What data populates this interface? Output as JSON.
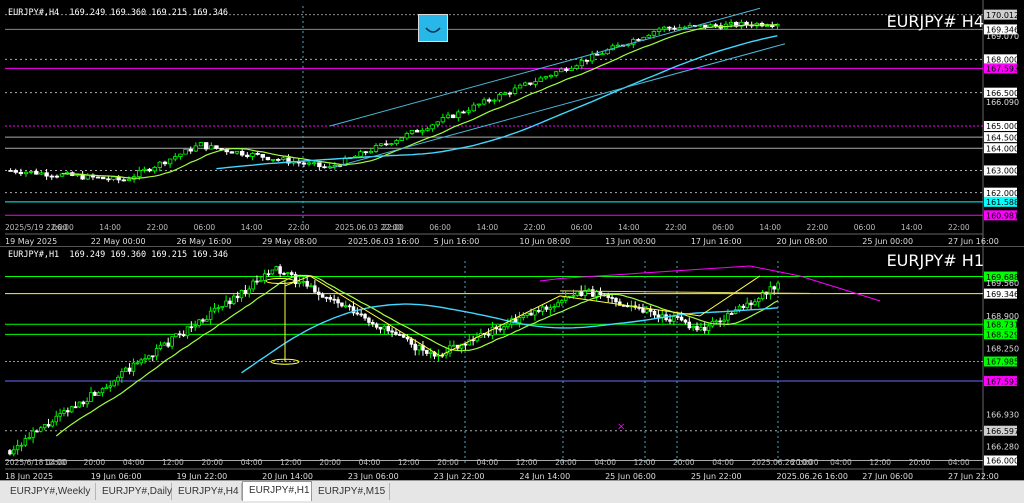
{
  "h4": {
    "symbol_line": "EURJPY#,H4  169.249 169.360 169.215 169.346",
    "title": "EURJPY# H4",
    "y_min": 160.5,
    "y_max": 170.4,
    "price_labels": [
      {
        "text": "170.012",
        "v": 170.012,
        "bg": "#cfcfcf",
        "fg": "#000"
      },
      {
        "text": "169.346",
        "v": 169.346,
        "bg": "#ffffff",
        "fg": "#000"
      },
      {
        "text": "169.070",
        "v": 169.07,
        "bg": "",
        "fg": "#ddd"
      },
      {
        "text": "168.000",
        "v": 168.0,
        "bg": "#ffffff",
        "fg": "#000"
      },
      {
        "text": "167.593",
        "v": 167.593,
        "bg": "#ff00ff",
        "fg": "#000"
      },
      {
        "text": "166.500",
        "v": 166.5,
        "bg": "#ffffff",
        "fg": "#000"
      },
      {
        "text": "166.090",
        "v": 166.09,
        "bg": "",
        "fg": "#ddd"
      },
      {
        "text": "165.000",
        "v": 165.0,
        "bg": "#ffffff",
        "fg": "#000"
      },
      {
        "text": "164.500",
        "v": 164.5,
        "bg": "#ffffff",
        "fg": "#000"
      },
      {
        "text": "164.000",
        "v": 164.0,
        "bg": "#ffffff",
        "fg": "#000"
      },
      {
        "text": "163.000",
        "v": 163.0,
        "bg": "#ffffff",
        "fg": "#000"
      },
      {
        "text": "162.000",
        "v": 162.0,
        "bg": "#ffffff",
        "fg": "#000"
      },
      {
        "text": "161.588",
        "v": 161.588,
        "bg": "#00ffff",
        "fg": "#000"
      },
      {
        "text": "160.981",
        "v": 160.981,
        "bg": "#ff00ff",
        "fg": "#000"
      }
    ],
    "hlines": [
      {
        "v": 170.012,
        "color": "#888888",
        "dash": "2,2"
      },
      {
        "v": 169.346,
        "color": "#888888",
        "dash": ""
      },
      {
        "v": 168.0,
        "color": "#aaaaaa",
        "dash": "2,3"
      },
      {
        "v": 167.593,
        "color": "#ff00ff",
        "dash": ""
      },
      {
        "v": 166.5,
        "color": "#aaaaaa",
        "dash": "2,3"
      },
      {
        "v": 165.0,
        "color": "#ff00ff",
        "dash": "2,2"
      },
      {
        "v": 164.5,
        "color": "#aaaaaa",
        "dash": ""
      },
      {
        "v": 164.0,
        "color": "#aaaaaa",
        "dash": ""
      },
      {
        "v": 163.0,
        "color": "#aaaaaa",
        "dash": "2,3"
      },
      {
        "v": 162.0,
        "color": "#aaaaaa",
        "dash": "2,3"
      },
      {
        "v": 161.588,
        "color": "#00ffff",
        "dash": ""
      },
      {
        "v": 160.981,
        "color": "#ff00ff",
        "dash": ""
      }
    ],
    "date_labels": [
      "19 May 2025",
      "22 May 00:00",
      "26 May 16:00",
      "29 May 08:00",
      "2025.06.03 16:00",
      "5 Jun 16:00",
      "10 Jun 08:00",
      "13 Jun 00:00",
      "17 Jun 16:00",
      "20 Jun 08:00",
      "25 Jun 00:00",
      "27 Jun 16:00"
    ],
    "upper_time_labels": [
      "2025/5/19 22:00",
      "06:00",
      "14:00",
      "22:00",
      "06:00",
      "14:00",
      "22:00",
      "2025.06.03 22:00",
      "22:00",
      "06:00",
      "14:00",
      "22:00",
      "06:00",
      "14:00",
      "22:00",
      "06:00",
      "14:00",
      "22:00",
      "06:00",
      "14:00",
      "22:00"
    ]
  },
  "h1": {
    "symbol_line": "EURJPY#,H1  169.249 169.360 169.215 169.346",
    "title": "EURJPY# H1",
    "y_min": 165.95,
    "y_max": 170.0,
    "price_labels": [
      {
        "text": "169.688",
        "v": 169.688,
        "bg": "#00ff00",
        "fg": "#000"
      },
      {
        "text": "169.560",
        "v": 169.56,
        "bg": "",
        "fg": "#ddd"
      },
      {
        "text": "169.346",
        "v": 169.346,
        "bg": "#ffffff",
        "fg": "#000"
      },
      {
        "text": "168.900",
        "v": 168.9,
        "bg": "",
        "fg": "#ddd"
      },
      {
        "text": "168.731",
        "v": 168.731,
        "bg": "#00ff00",
        "fg": "#000"
      },
      {
        "text": "168.529",
        "v": 168.529,
        "bg": "#00ff00",
        "fg": "#000"
      },
      {
        "text": "168.250",
        "v": 168.25,
        "bg": "",
        "fg": "#ddd"
      },
      {
        "text": "167.985",
        "v": 167.985,
        "bg": "#00ff00",
        "fg": "#000"
      },
      {
        "text": "167.593",
        "v": 167.593,
        "bg": "#ff00ff",
        "fg": "#000"
      },
      {
        "text": "166.930",
        "v": 166.93,
        "bg": "",
        "fg": "#ddd"
      },
      {
        "text": "166.597",
        "v": 166.597,
        "bg": "#cfcfcf",
        "fg": "#000"
      },
      {
        "text": "166.280",
        "v": 166.28,
        "bg": "",
        "fg": "#ddd"
      },
      {
        "text": "166.000",
        "v": 166.0,
        "bg": "#ffffff",
        "fg": "#000"
      }
    ],
    "hlines": [
      {
        "v": 169.688,
        "color": "#00ff00",
        "dash": ""
      },
      {
        "v": 169.346,
        "color": "#ffff00",
        "dash": ""
      },
      {
        "v": 168.731,
        "color": "#00ff00",
        "dash": ""
      },
      {
        "v": 168.529,
        "color": "#00ff00",
        "dash": ""
      },
      {
        "v": 167.985,
        "color": "#00ff00",
        "dash": "2,2"
      },
      {
        "v": 167.593,
        "color": "#6a6aff",
        "dash": ""
      },
      {
        "v": 166.597,
        "color": "#aaaaaa",
        "dash": "2,3"
      },
      {
        "v": 166.0,
        "color": "#aaaaaa",
        "dash": ""
      }
    ],
    "date_labels": [
      "18 Jun 2025",
      "19 Jun 06:00",
      "19 Jun 22:00",
      "20 Jun 14:00",
      "23 Jun 06:00",
      "23 Jun 22:00",
      "24 Jun 14:00",
      "25 Jun 06:00",
      "25 Jun 22:00",
      "2025.06.26 16:00",
      "27 Jun 06:00",
      "27 Jun 22:00"
    ],
    "upper_time_labels": [
      "2025/6/18 04:00",
      "12:00",
      "20:00",
      "04:00",
      "12:00",
      "20:00",
      "04:00",
      "12:00",
      "20:00",
      "04:00",
      "12:00",
      "20:00",
      "04:00",
      "12:00",
      "20:00",
      "04:00",
      "12:00",
      "20:00",
      "04:00",
      "2025.06.26 10:00",
      "20:00",
      "04:00",
      "12:00",
      "20:00",
      "04:00"
    ]
  },
  "tabs": [
    {
      "label": "EURJPY#,Weekly",
      "active": false
    },
    {
      "label": "EURJPY#,Daily",
      "active": false
    },
    {
      "label": "EURJPY#,H4",
      "active": false
    },
    {
      "label": "EURJPY#,H1",
      "active": true
    },
    {
      "label": "EURJPY#,M15",
      "active": false
    }
  ],
  "colors": {
    "bull": "#00ff00",
    "bear": "#ffffff",
    "ma_fast": "#a0ff40",
    "ma_slow": "#40d8ff",
    "channel": "#4ab8d8",
    "trend": "#ffff40"
  }
}
